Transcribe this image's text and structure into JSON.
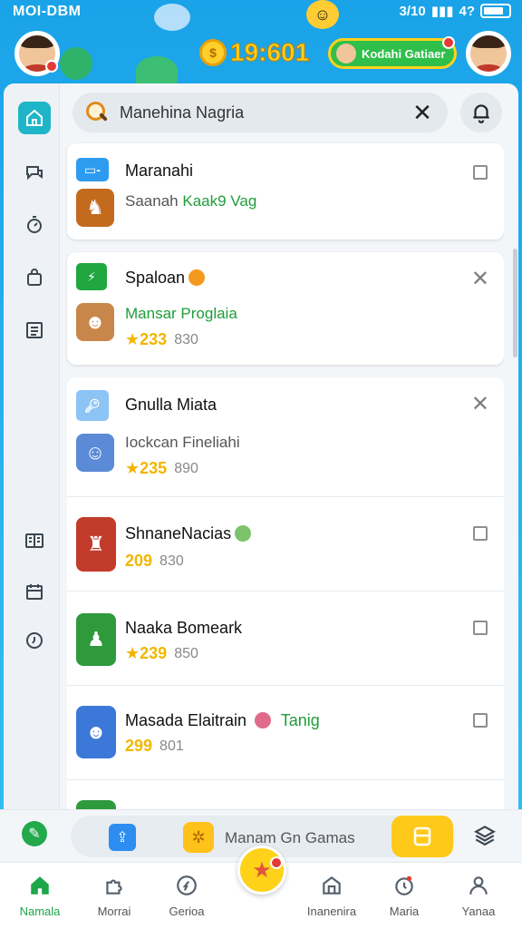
{
  "status": {
    "time": "MOI-DBM",
    "right": "3/10",
    "signal": "4?"
  },
  "header": {
    "coins": "19:601",
    "pill_label": "Kodahi Gatiaer"
  },
  "search": {
    "value": "Manehina Nagria"
  },
  "list": {
    "items": [
      {
        "title": "Maranahi",
        "subtitle_gray": "Saanah",
        "subtitle_green": "Kaak9 Vag"
      },
      {
        "title": "Spaloan",
        "subtitle": "Mansar Proglaia",
        "rating": "233",
        "count": "830"
      },
      {
        "title": "Gnulla Miata",
        "subtitle": "Iockcan Fineliahi",
        "rating": "235",
        "count": "890"
      },
      {
        "title": "ShnaneNacias",
        "rating": "209",
        "count": "830"
      },
      {
        "title": "Naaka Bomeark",
        "rating": "239",
        "count": "850"
      },
      {
        "title": "Masada Elaitrain",
        "tag": "Tanig",
        "rating": "299",
        "count": "801"
      }
    ]
  },
  "toolbar": {
    "label": "Manam Gn Gamas"
  },
  "nav": {
    "items": [
      {
        "label": "Namala"
      },
      {
        "label": "Morrai"
      },
      {
        "label": "Gerioa"
      },
      {
        "label": "Inanenira"
      },
      {
        "label": "Maria"
      },
      {
        "label": "Yanaa"
      }
    ]
  },
  "colors": {
    "accent": "#1fb5c8",
    "green": "#1f9d3a",
    "gold": "#f2b600",
    "sky": "#1aa3e8"
  }
}
